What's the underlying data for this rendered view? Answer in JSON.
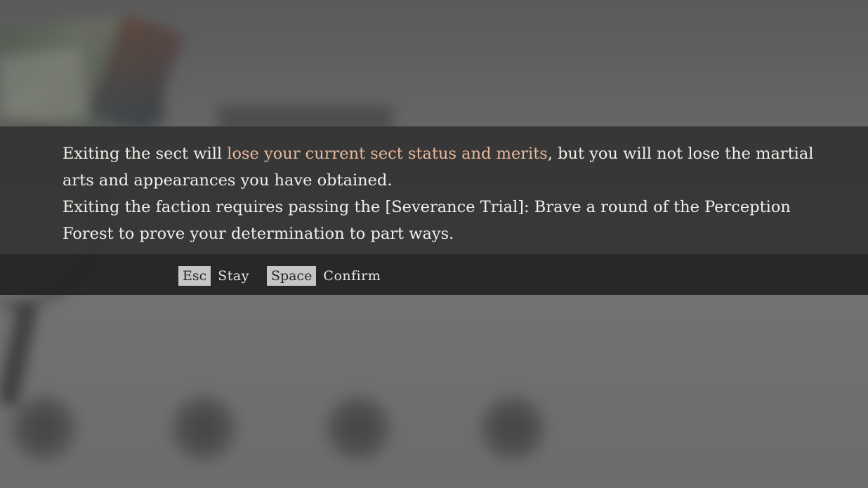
{
  "dialog": {
    "line1_before": "Exiting the sect will ",
    "line1_highlight": "lose your current sect status and merits",
    "line1_after": ", but you will not lose the martial arts and appearances you have obtained.",
    "line2": "Exiting the faction requires passing the [Severance Trial]: Brave a round of the Perception Forest to prove your determination to part ways.",
    "highlight_color": "#e8b99b"
  },
  "actions": {
    "stay": {
      "key": "Esc",
      "label": "Stay"
    },
    "confirm": {
      "key": "Space",
      "label": "Confirm"
    }
  }
}
